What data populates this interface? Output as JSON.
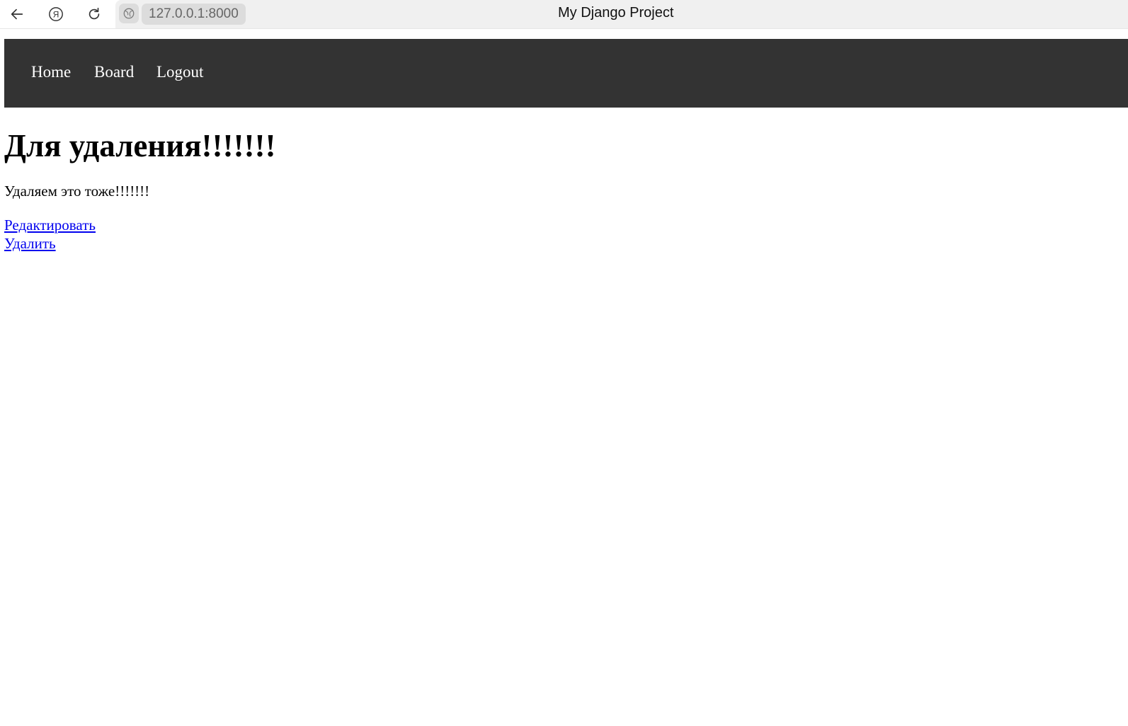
{
  "browser": {
    "url": "127.0.0.1:8000",
    "tab_title": "My Django Project",
    "icons": {
      "back": "arrow-left-icon",
      "home": "yandex-icon",
      "reload": "reload-icon",
      "site": "globe-icon"
    }
  },
  "nav": {
    "items": [
      {
        "label": "Home"
      },
      {
        "label": "Board"
      },
      {
        "label": "Logout"
      }
    ]
  },
  "post": {
    "title": "Для удаления!!!!!!!",
    "body": "Удаляем это тоже!!!!!!!",
    "edit_link": "Редактировать",
    "delete_link": "Удалить"
  },
  "colors": {
    "navbar_bg": "#333333",
    "link": "#0000ee"
  }
}
